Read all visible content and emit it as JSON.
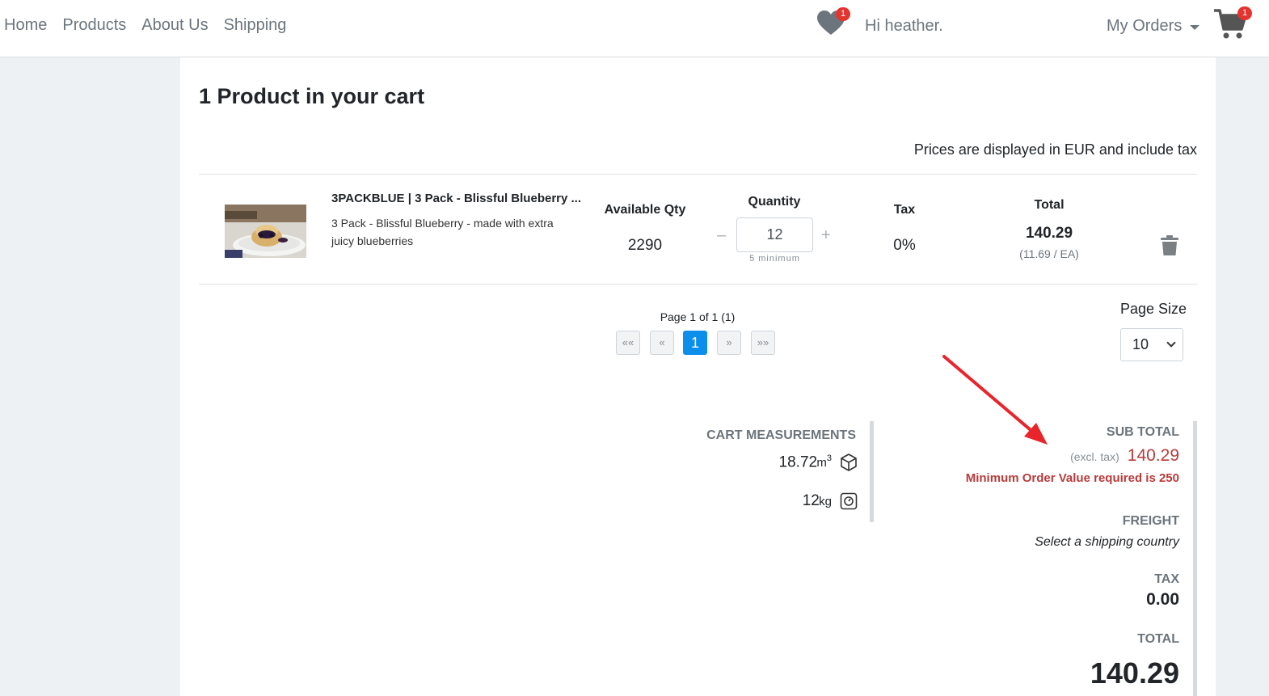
{
  "nav": {
    "links": [
      "Home",
      "Products",
      "About Us",
      "Shipping"
    ],
    "wishlist_count": "1",
    "greeting": "Hi heather.",
    "orders_label": "My Orders",
    "cart_count": "1"
  },
  "cart": {
    "title": "1 Product in your cart",
    "tax_note": "Prices are displayed in EUR and include tax",
    "item": {
      "title": "3PACKBLUE | 3 Pack - Blissful Blueberry ...",
      "description": "3 Pack - Blissful Blueberry - made with extra juicy blueberries",
      "available_qty_label": "Available Qty",
      "available_qty": "2290",
      "quantity_label": "Quantity",
      "quantity": "12",
      "minimum_note": "5 minimum",
      "tax_label": "Tax",
      "tax": "0%",
      "total_label": "Total",
      "total": "140.29",
      "unit_price": "(11.69 / EA)"
    }
  },
  "pagination": {
    "info": "Page 1 of 1 (1)",
    "first": "««",
    "prev": "«",
    "current": "1",
    "next": "»",
    "last": "»»",
    "page_size_label": "Page Size",
    "page_size": "10"
  },
  "measurements": {
    "title": "CART MEASUREMENTS",
    "volume": "18.72",
    "volume_unit": "m",
    "volume_exp": "3",
    "weight": "12",
    "weight_unit": "kg"
  },
  "totals": {
    "subtotal_label": "SUB TOTAL",
    "excl_tax": "(excl. tax)",
    "subtotal": "140.29",
    "min_order_warning": "Minimum Order Value required is 250",
    "freight_label": "FREIGHT",
    "freight_note": "Select a shipping country",
    "tax_label": "TAX",
    "tax": "0.00",
    "total_label": "TOTAL",
    "total": "140.29"
  },
  "colors": {
    "accent": "#0d8eed",
    "warning": "#b83a3a",
    "badge": "#e3342f",
    "annotation_arrow": "#e8242c"
  }
}
